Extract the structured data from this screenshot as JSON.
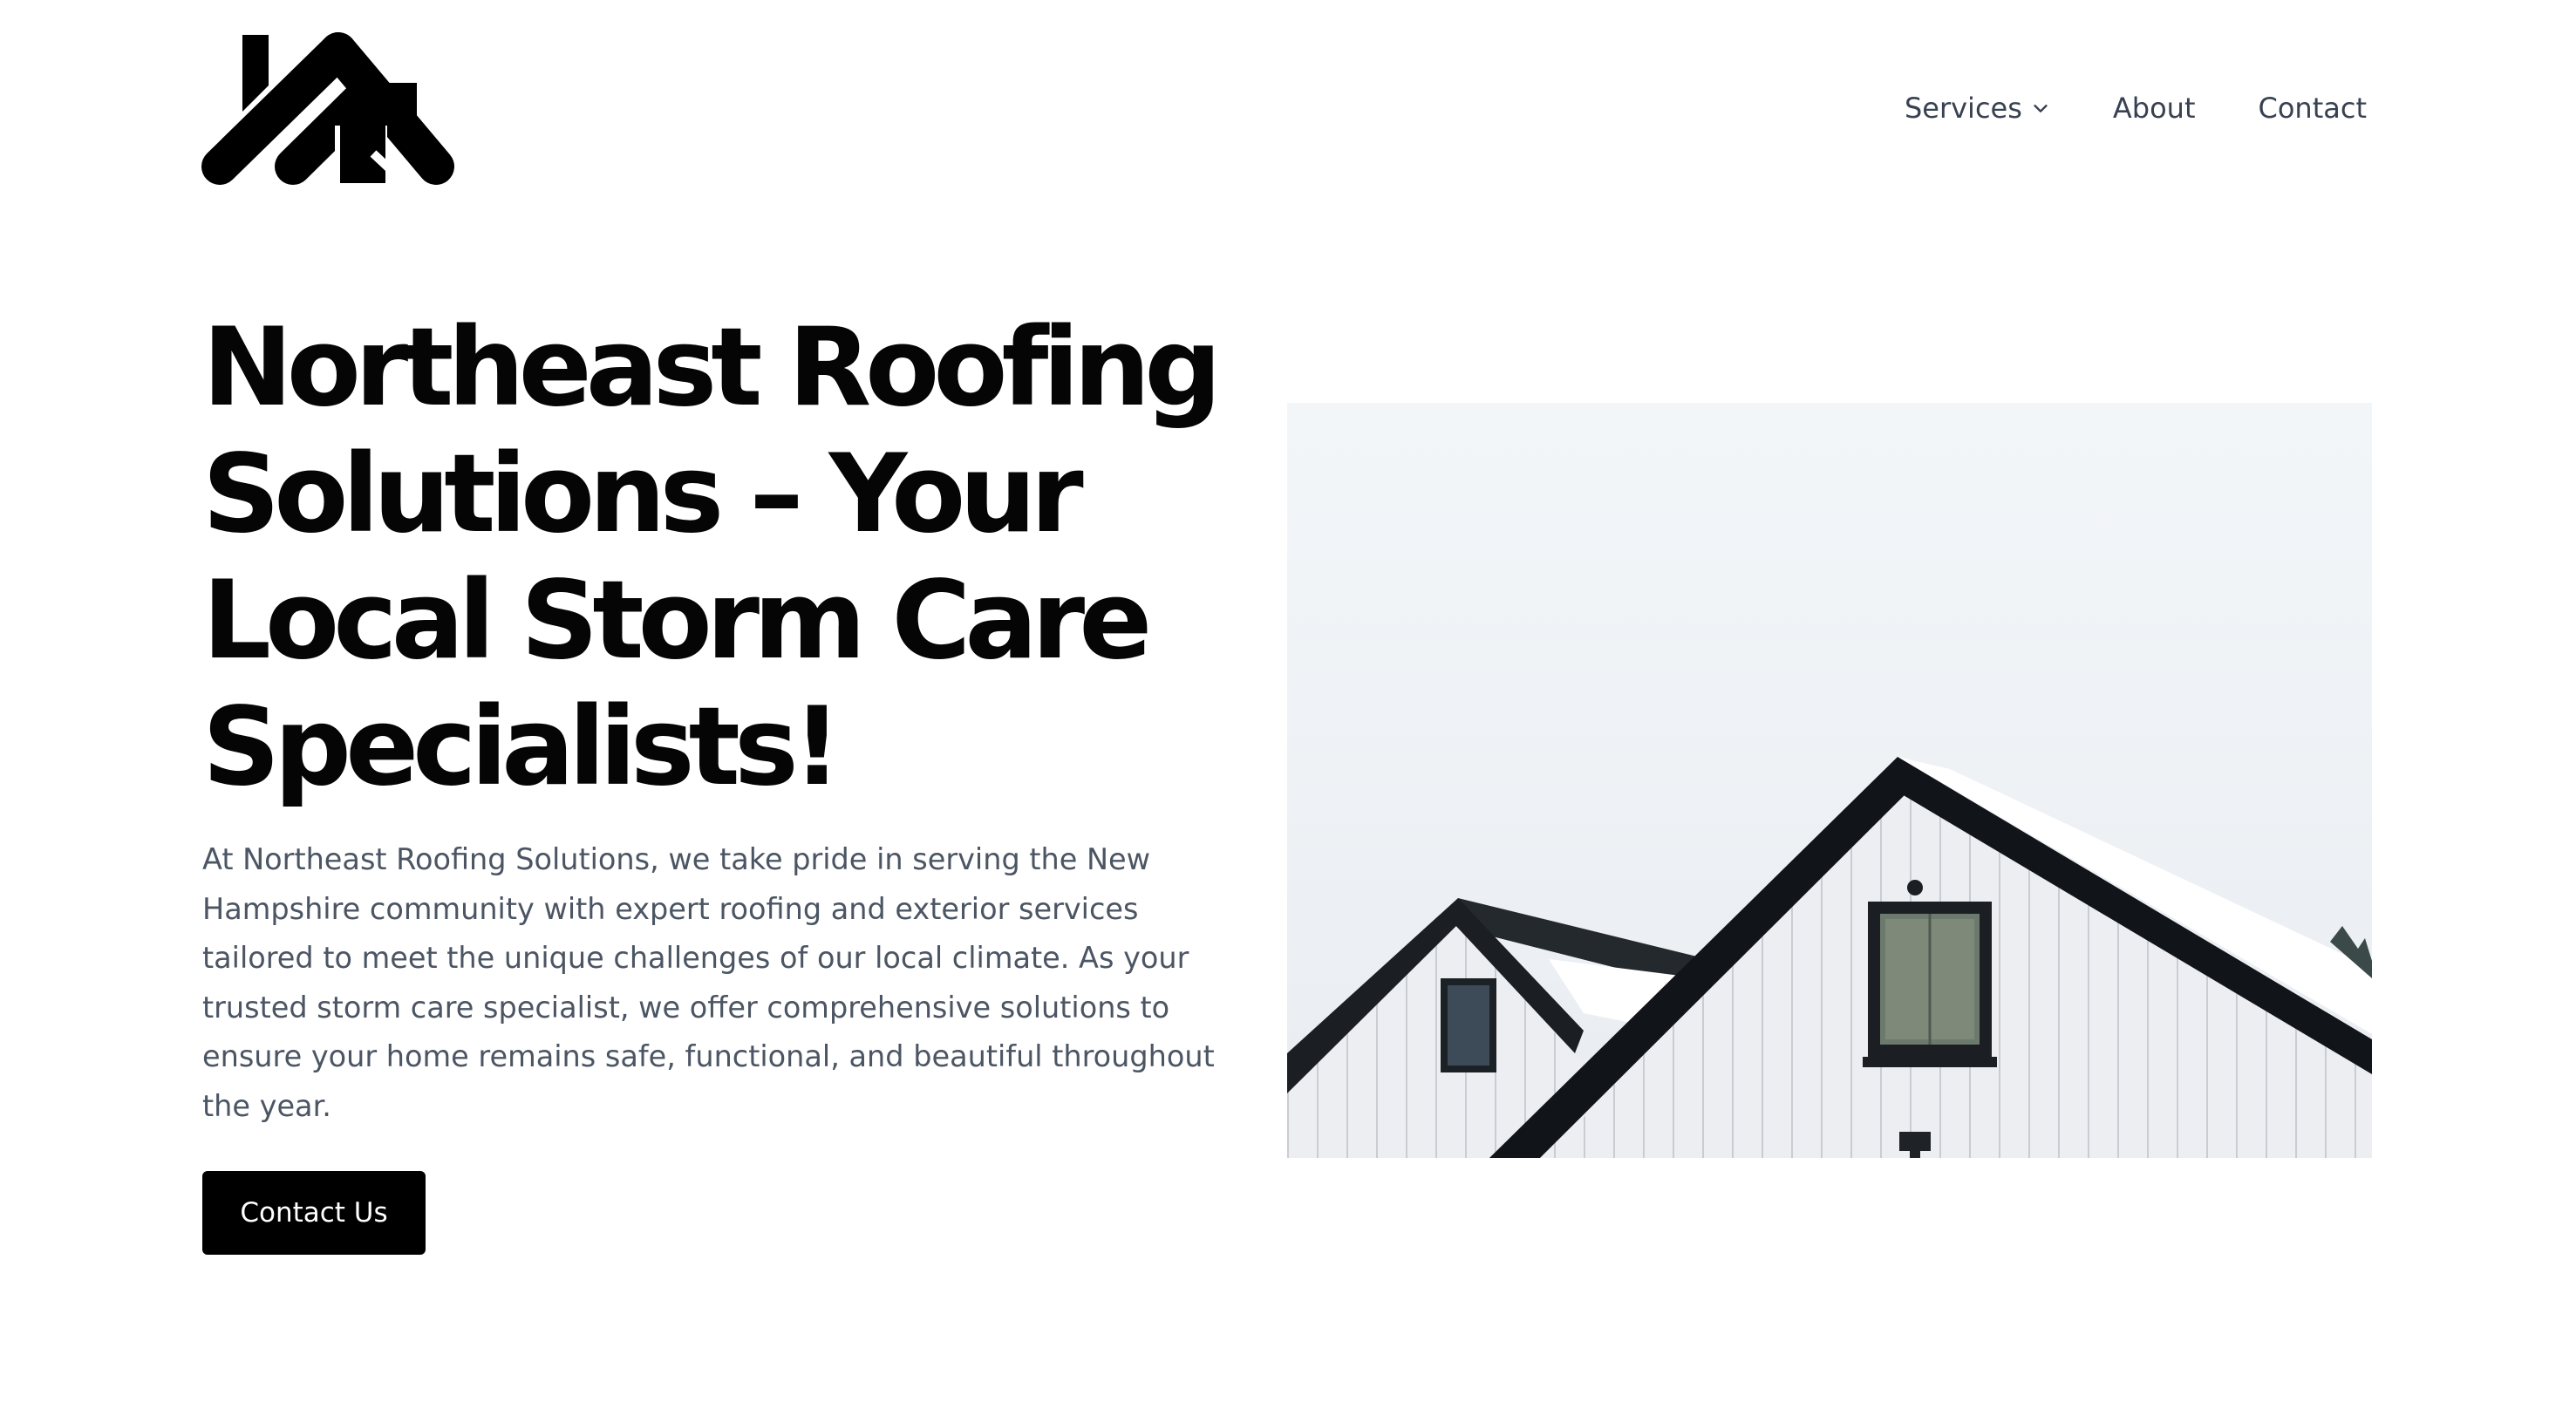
{
  "header": {
    "logo_icon": "roofing-logo-icon",
    "nav": [
      {
        "label": "Services",
        "has_dropdown": true,
        "icon": "chevron-down-icon"
      },
      {
        "label": "About"
      },
      {
        "label": "Contact"
      }
    ]
  },
  "hero": {
    "title": "Northeast Roofing Solutions – Your Local Storm Care Specialists!",
    "description": "At Northeast Roofing Solutions, we take pride in serving the New Hampshire community with expert roofing and exterior services tailored to meet the unique challenges of our local climate. As your trusted storm care specialist, we offer comprehensive solutions to ensure your home remains safe, functional, and beautiful throughout the year.",
    "cta_label": "Contact Us",
    "image": "snow-covered-house-roof-image"
  },
  "colors": {
    "text_primary": "#050505",
    "text_muted": "#4b5563",
    "nav_text": "#374151",
    "button_bg": "#000000",
    "button_text": "#ffffff",
    "background": "#ffffff"
  }
}
